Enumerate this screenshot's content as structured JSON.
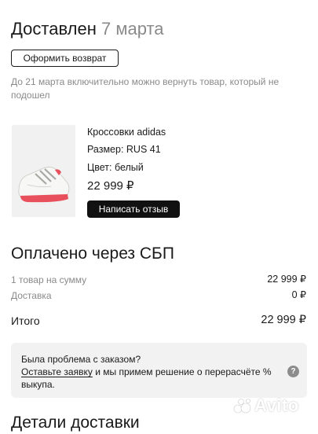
{
  "status": {
    "title": "Доставлен",
    "date": "7 марта"
  },
  "return_button": "Оформить возврат",
  "return_note": "До 21 марта включительно можно вернуть товар, который не подошел",
  "product": {
    "name": "Кроссовки adidas",
    "size": "Размер: RUS 41",
    "color": "Цвет: белый",
    "price": "22 999 ₽",
    "review_button": "Написать отзыв"
  },
  "payment": {
    "title": "Оплачено через СБП",
    "rows": [
      {
        "label": "1 товар на сумму",
        "value": "22 999 ₽"
      },
      {
        "label": "Доставка",
        "value": "0 ₽"
      }
    ],
    "total_label": "Итого",
    "total_value": "22 999 ₽"
  },
  "problem": {
    "question": "Была проблема с заказом?",
    "link": "Оставьте заявку",
    "text": " и мы примем решение о перерасчёте % выкупа.",
    "icon": "help-icon"
  },
  "delivery_details_title": "Детали доставки",
  "watermark": "Avito",
  "colors": {
    "accent_dark": "#111111",
    "muted": "#8a8a8a",
    "box_bg": "#f2f2f2",
    "shoe_accent": "#e8505b"
  }
}
